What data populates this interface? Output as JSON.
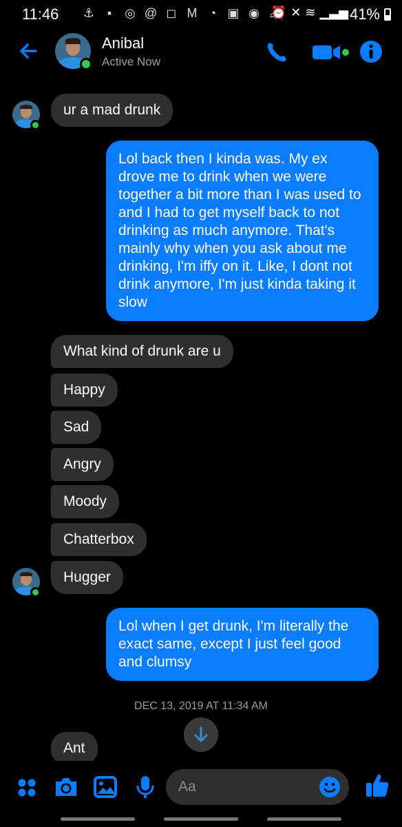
{
  "status_bar": {
    "time": "11:46",
    "battery": "41%"
  },
  "header": {
    "contact_name": "Anibal",
    "status": "Active Now"
  },
  "messages": {
    "m1": "ur a mad drunk",
    "m2": "Lol back then I kinda was. My ex drove me to drink when we were together a bit more than I was used to and I had to get myself back to not drinking as much anymore. That's mainly why when you ask about me drinking, I'm iffy on it. Like, I dont not drink anymore, I'm just kinda taking it slow",
    "m3": "What kind of drunk are u",
    "m4": "Happy",
    "m5": "Sad",
    "m6": "Angry",
    "m7": "Moody",
    "m8": "Chatterbox",
    "m9": "Hugger",
    "m10": "Lol when I get drunk, I'm literally the exact same, except I just feel good and clumsy",
    "timestamp": "DEC 13, 2019 AT 11:34 AM",
    "m11": "Ant"
  },
  "composer": {
    "placeholder": "Aa"
  },
  "colors": {
    "accent": "#0a7cff",
    "incoming_bubble": "#2f2f2f",
    "online": "#31cc46",
    "background": "#000000"
  },
  "icons": [
    "back-arrow-icon",
    "phone-icon",
    "video-camera-icon",
    "info-icon",
    "apps-grid-icon",
    "camera-icon",
    "gallery-icon",
    "microphone-icon",
    "emoji-icon",
    "thumbs-up-icon",
    "arrow-down-icon"
  ]
}
